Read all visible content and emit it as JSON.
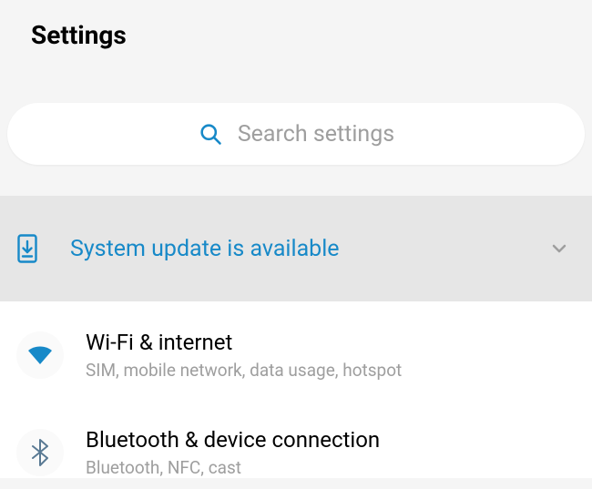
{
  "header": {
    "title": "Settings"
  },
  "search": {
    "placeholder": "Search settings"
  },
  "banner": {
    "text": "System update is available",
    "accent_color": "#1789c8"
  },
  "items": [
    {
      "icon": "wifi-icon",
      "title": "Wi-Fi & internet",
      "subtitle": "SIM, mobile network, data usage, hotspot"
    },
    {
      "icon": "bluetooth-icon",
      "title": "Bluetooth & device connection",
      "subtitle": "Bluetooth, NFC, cast"
    }
  ]
}
